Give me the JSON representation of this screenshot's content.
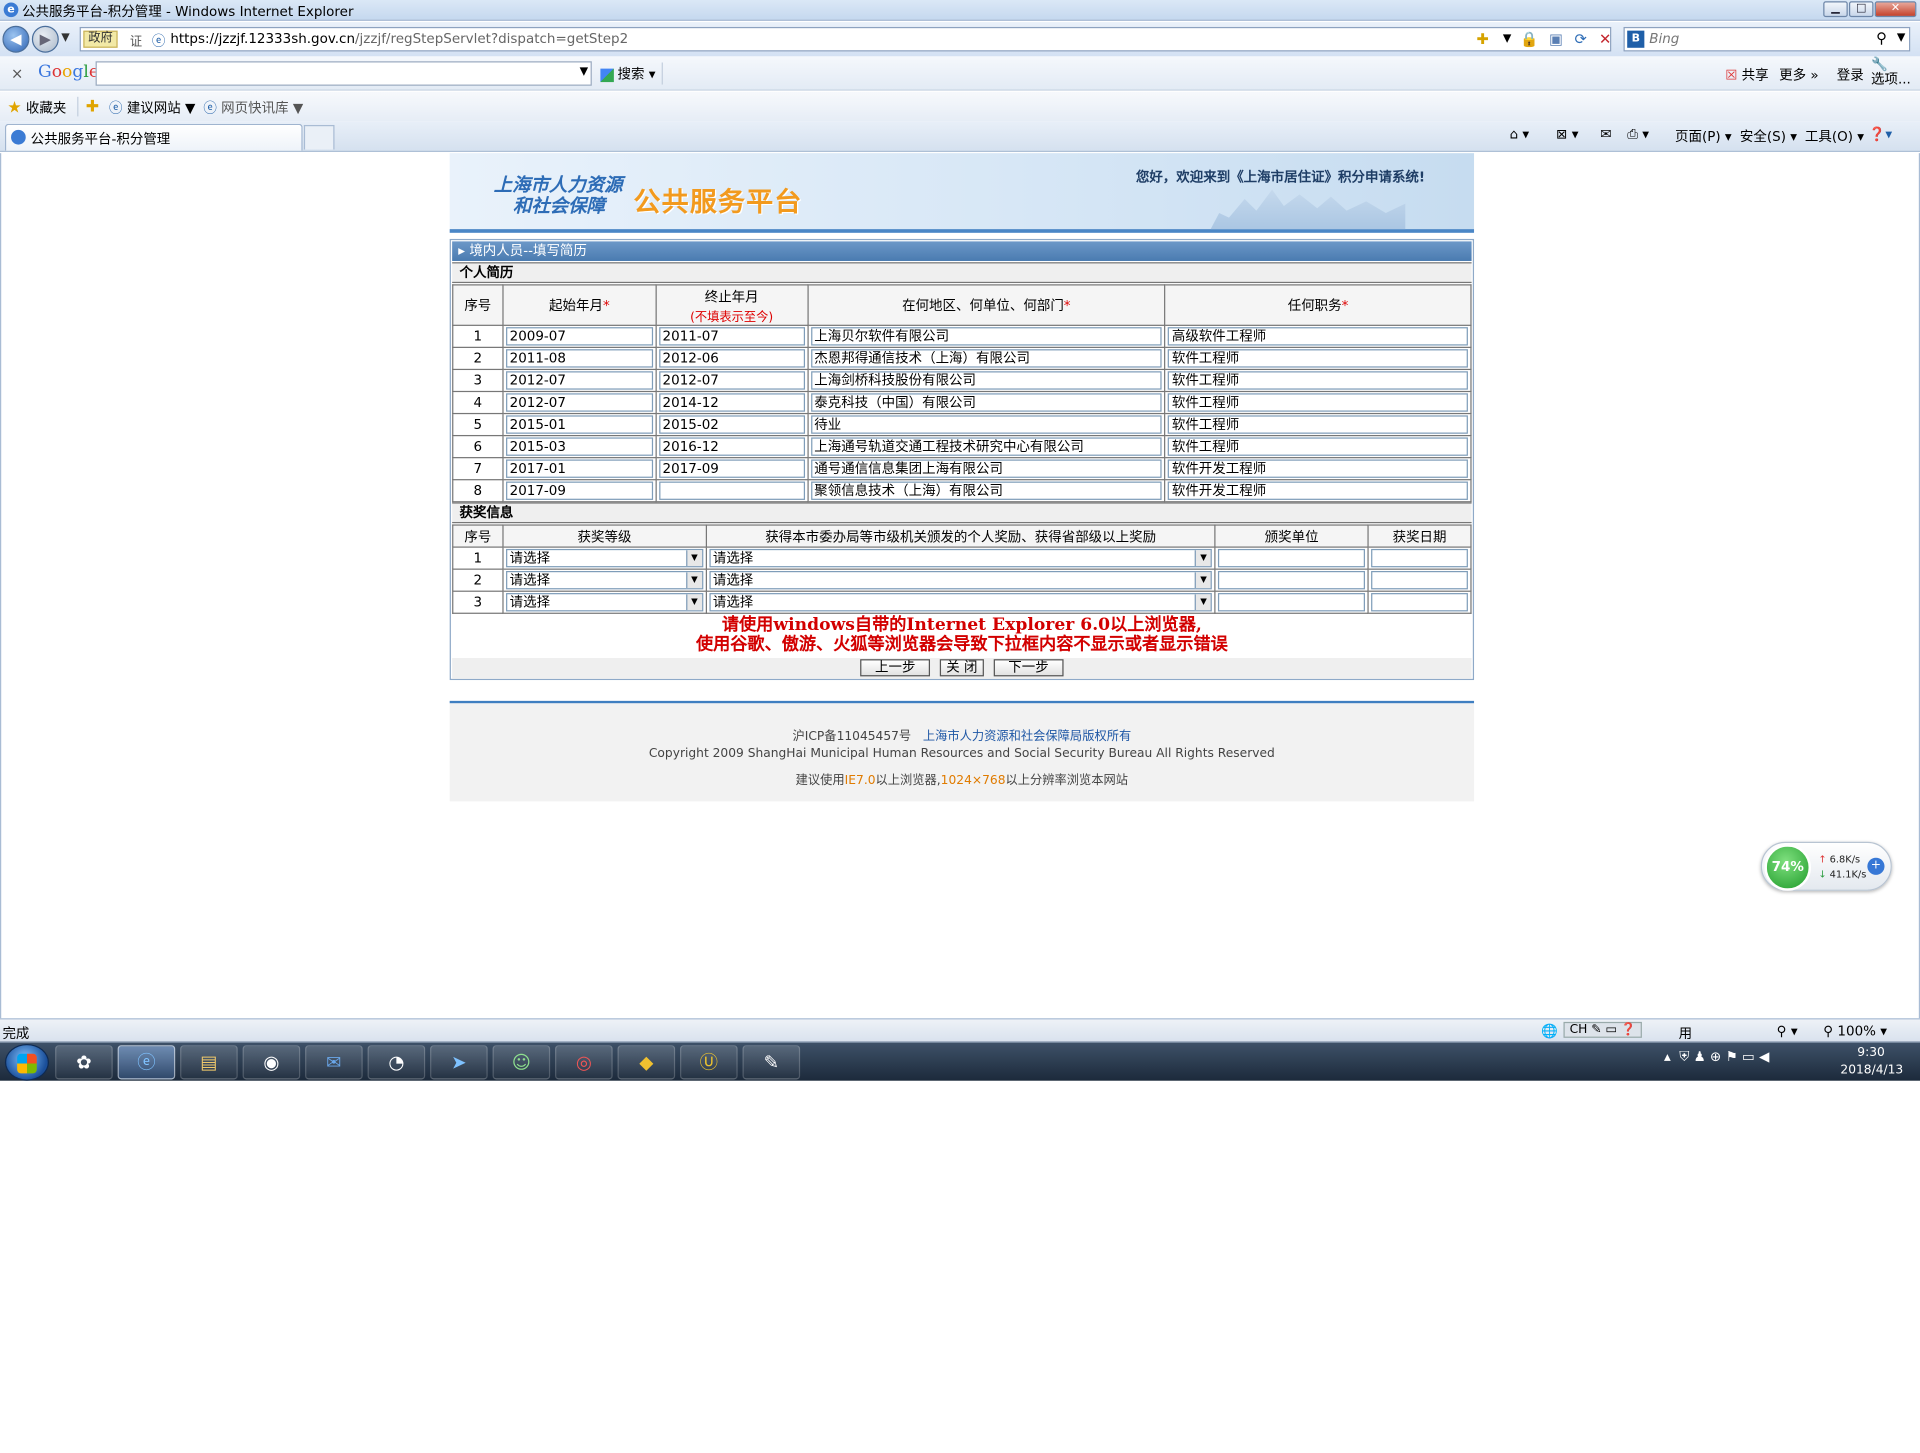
{
  "window": {
    "title": "公共服务平台-积分管理 - Windows Internet Explorer"
  },
  "address_bar": {
    "zone_label": "政府",
    "cert_label": "证",
    "url_host": "https://jzzjf.12333sh.gov.cn",
    "url_path": "/jzzjf/regStepServlet?dispatch=getStep2",
    "search_placeholder": "Bing"
  },
  "google_toolbar": {
    "logo": "Google",
    "search_label": "搜索",
    "share_label": "共享",
    "more_label": "更多 »",
    "login_label": "登录",
    "options_label": "选项..."
  },
  "favorites_bar": {
    "favorites_label": "收藏夹",
    "item1": "建议网站 ▼",
    "item2": "网页快讯库 ▼"
  },
  "tab": {
    "label": "公共服务平台-积分管理"
  },
  "command_bar": {
    "page": "页面(P) ▾",
    "safety": "安全(S) ▾",
    "tools": "工具(O) ▾"
  },
  "banner": {
    "org_line1": "上海市人力资源",
    "org_line2": "和社会保障",
    "platform": "公共服务平台",
    "welcome": "您好，欢迎来到《上海市居住证》积分申请系统!"
  },
  "form": {
    "section_title": "境内人员--填写简历",
    "resume_heading": "个人简历",
    "resume_headers": {
      "seq": "序号",
      "start": "起始年月",
      "end": "终止年月",
      "end_note": "(不填表示至今)",
      "org": "在何地区、何单位、何部门",
      "position": "任何职务",
      "req_mark": "*"
    },
    "resume_rows": [
      {
        "seq": "1",
        "start": "2009-07",
        "end": "2011-07",
        "org": "上海贝尔软件有限公司",
        "position": "高级软件工程师"
      },
      {
        "seq": "2",
        "start": "2011-08",
        "end": "2012-06",
        "org": "杰恩邦得通信技术（上海）有限公司",
        "position": "软件工程师"
      },
      {
        "seq": "3",
        "start": "2012-07",
        "end": "2012-07",
        "org": "上海剑桥科技股份有限公司",
        "position": "软件工程师"
      },
      {
        "seq": "4",
        "start": "2012-07",
        "end": "2014-12",
        "org": "泰克科技（中国）有限公司",
        "position": "软件工程师"
      },
      {
        "seq": "5",
        "start": "2015-01",
        "end": "2015-02",
        "org": "待业",
        "position": "软件工程师"
      },
      {
        "seq": "6",
        "start": "2015-03",
        "end": "2016-12",
        "org": "上海通号轨道交通工程技术研究中心有限公司",
        "position": "软件工程师"
      },
      {
        "seq": "7",
        "start": "2017-01",
        "end": "2017-09",
        "org": "通号通信信息集团上海有限公司",
        "position": "软件开发工程师"
      },
      {
        "seq": "8",
        "start": "2017-09",
        "end": "",
        "org": "聚领信息技术（上海）有限公司",
        "position": "软件开发工程师"
      }
    ],
    "award_heading": "获奖信息",
    "award_headers": {
      "seq": "序号",
      "level": "获奖等级",
      "award": "获得本市委办局等市级机关颁发的个人奖励、获得省部级以上奖励",
      "issuer": "颁奖单位",
      "date": "获奖日期"
    },
    "award_rows": [
      {
        "seq": "1",
        "level": "请选择",
        "award": "请选择",
        "issuer": "",
        "date": ""
      },
      {
        "seq": "2",
        "level": "请选择",
        "award": "请选择",
        "issuer": "",
        "date": ""
      },
      {
        "seq": "3",
        "level": "请选择",
        "award": "请选择",
        "issuer": "",
        "date": ""
      }
    ],
    "warning_line1": "请使用windows自带的Internet Explorer 6.0以上浏览器,",
    "warning_line2": "使用谷歌、傲游、火狐等浏览器会导致下拉框内容不显示或者显示错误",
    "buttons": {
      "prev": "上一步",
      "close": "关 闭",
      "next": "下一步"
    }
  },
  "footer": {
    "icp": "沪ICP备11045457号",
    "owner": "上海市人力资源和社会保障局版权所有",
    "copyright": "Copyright 2009 ShangHai Municipal Human Resources and Social Security Bureau All Rights Reserved",
    "advice_pre": "建议使用",
    "advice_ie": "IE7.0",
    "advice_mid": "以上浏览器,",
    "advice_res": "1024×768",
    "advice_post": "以上分辨率浏览本网站"
  },
  "net_widget": {
    "percent": "74%",
    "up": "6.8K/s",
    "down": "41.1K/s"
  },
  "status_bar": {
    "status": "完成",
    "lang": "CH",
    "zoom": "100%",
    "tray_text": "用"
  },
  "taskbar": {
    "time": "9:30",
    "date": "2018/4/13"
  },
  "colors": {
    "accent_blue": "#4a7bb0",
    "warning_red": "#d20000",
    "banner_orange": "#f29a1e"
  }
}
